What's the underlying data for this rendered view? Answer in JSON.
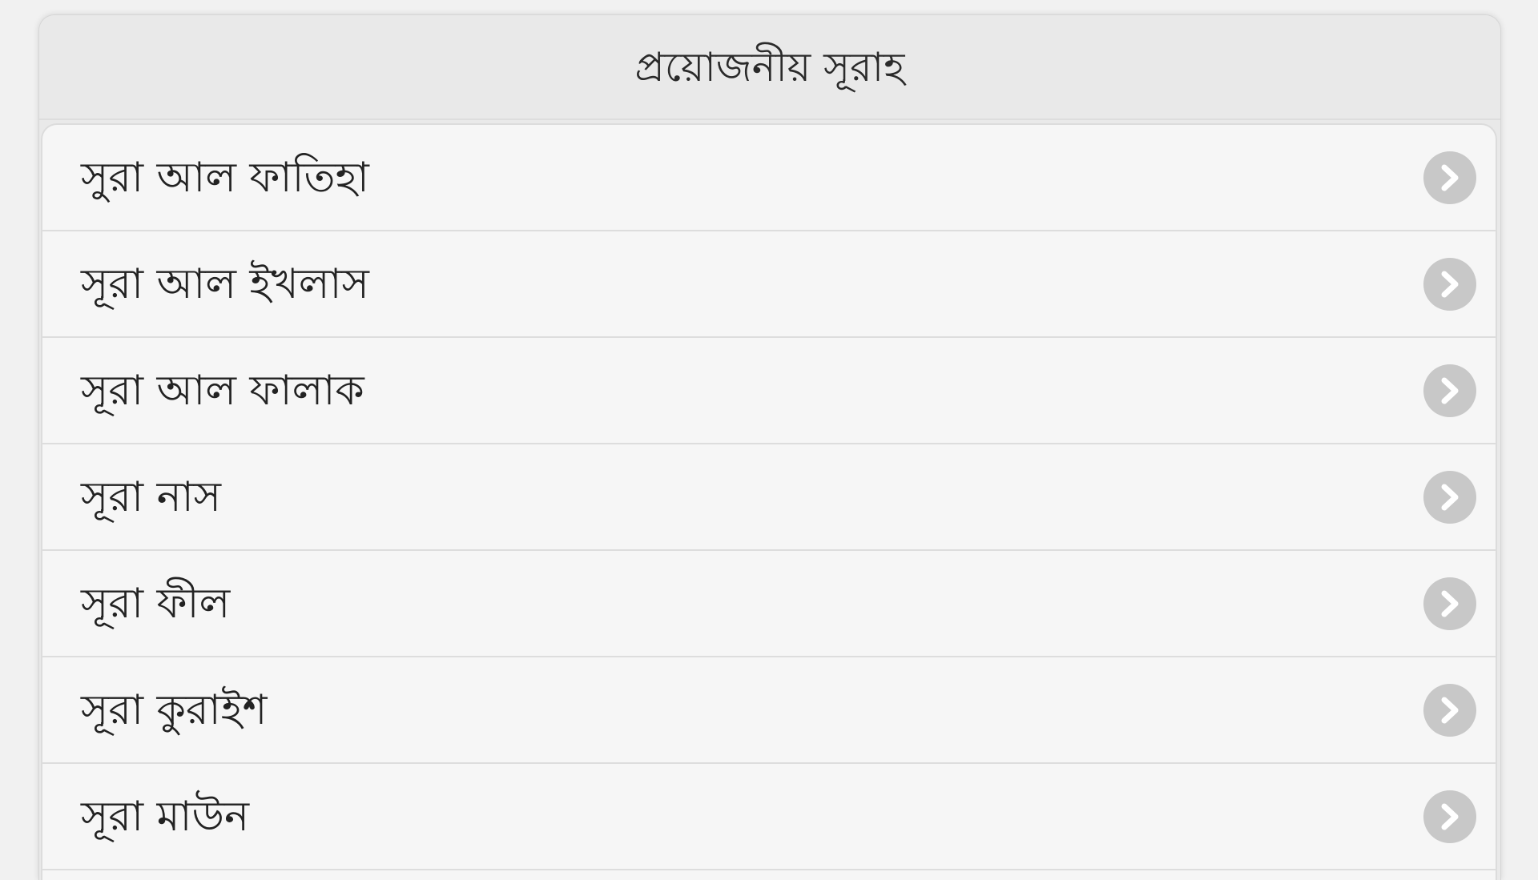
{
  "header": {
    "title": "প্রয়োজনীয় সূরাহ"
  },
  "list": {
    "items": [
      {
        "label": "সুরা আল ফাতিহা",
        "icon": "chevron-right-icon"
      },
      {
        "label": "সূরা আল ইখলাস",
        "icon": "chevron-right-icon"
      },
      {
        "label": "সূরা আল ফালাক",
        "icon": "chevron-right-icon"
      },
      {
        "label": "সূরা নাস",
        "icon": "chevron-right-icon"
      },
      {
        "label": "সূরা ফীল",
        "icon": "chevron-right-icon"
      },
      {
        "label": "সূরা কুরাইশ",
        "icon": "chevron-right-icon"
      },
      {
        "label": "সূরা মাউন",
        "icon": "chevron-right-icon"
      }
    ]
  },
  "colors": {
    "background": "#f1f1f1",
    "header_bg": "#e9e9e9",
    "list_bg": "#f6f6f6",
    "divider": "#dddddd",
    "chevron_circle": "#c8c8c8",
    "chevron_mark": "#ffffff",
    "text": "#222222"
  }
}
